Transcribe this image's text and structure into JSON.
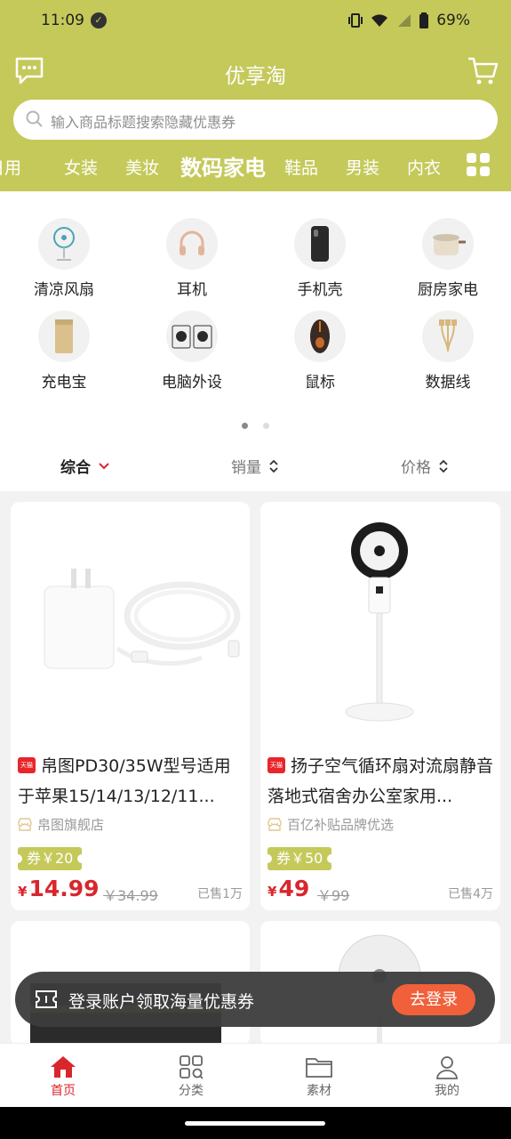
{
  "status_bar": {
    "time": "11:09",
    "battery": "69%"
  },
  "header": {
    "title": "优享淘",
    "message_icon": "message-icon",
    "cart_icon": "cart-icon"
  },
  "search": {
    "placeholder": "输入商品标题搜索隐藏优惠券"
  },
  "categories": [
    "日用",
    "女装",
    "美妆",
    "数码家电",
    "鞋品",
    "男装",
    "内衣"
  ],
  "active_category": "数码家电",
  "subcategories": [
    {
      "label": "清凉风扇",
      "icon": "fan-icon"
    },
    {
      "label": "耳机",
      "icon": "headphones-icon"
    },
    {
      "label": "手机壳",
      "icon": "phone-case-icon"
    },
    {
      "label": "厨房家电",
      "icon": "cooker-icon"
    },
    {
      "label": "充电宝",
      "icon": "power-bank-icon"
    },
    {
      "label": "电脑外设",
      "icon": "speakers-icon"
    },
    {
      "label": "鼠标",
      "icon": "mouse-icon"
    },
    {
      "label": "数据线",
      "icon": "cable-icon"
    }
  ],
  "sort": {
    "overall": "综合",
    "sales": "销量",
    "price": "价格"
  },
  "products": [
    {
      "title": "帛图PD30/35W型号适用于苹果15/14/13/12/11...",
      "badge": "天猫",
      "shop": "帛图旗舰店",
      "coupon": "券￥20",
      "currency": "¥",
      "price": "14.99",
      "original_price": "￥34.99",
      "sold": "已售1万"
    },
    {
      "title": "扬子空气循环扇对流扇静音落地式宿舍办公室家用...",
      "badge": "天猫",
      "shop": "百亿补贴品牌优选",
      "coupon": "券￥50",
      "currency": "¥",
      "price": "49",
      "original_price": "￥99",
      "sold": "已售4万"
    }
  ],
  "toast": {
    "text": "登录账户领取海量优惠券",
    "button": "去登录"
  },
  "tabs": [
    {
      "label": "首页",
      "icon": "home-icon"
    },
    {
      "label": "分类",
      "icon": "category-icon"
    },
    {
      "label": "素材",
      "icon": "folder-icon"
    },
    {
      "label": "我的",
      "icon": "user-icon"
    }
  ],
  "colors": {
    "brand": "#c4c95a",
    "price": "#d9262c",
    "toast_button": "#f0603a"
  }
}
